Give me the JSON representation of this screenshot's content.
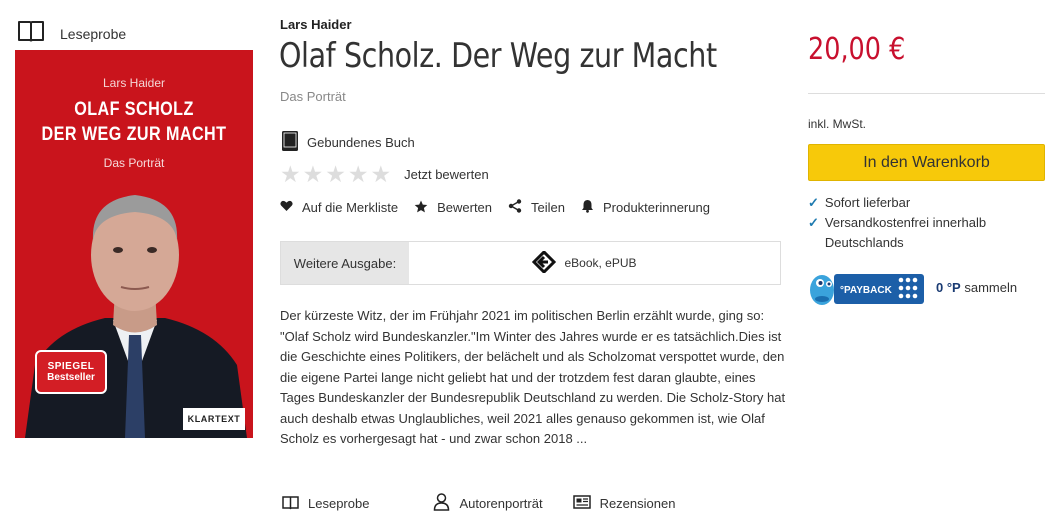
{
  "leseprobe_top": {
    "label": "Leseprobe",
    "icon": "open-book-icon"
  },
  "cover": {
    "author": "Lars Haider",
    "title_line1": "OLAF SCHOLZ",
    "title_line2": "DER WEG ZUR MACHT",
    "subtitle": "Das Porträt",
    "badge_line1": "SPIEGEL",
    "badge_line2": "Bestseller",
    "publisher": "KLARTEXT",
    "background_color": "#c9141c"
  },
  "product": {
    "author": "Lars Haider",
    "title": "Olaf Scholz. Der Weg zur Macht",
    "subtitle": "Das Porträt",
    "format": "Gebundenes Buch",
    "rating_stars": 0,
    "rating_max": 5,
    "rate_label": "Jetzt bewerten"
  },
  "actions": [
    {
      "label": "Auf die Merkliste",
      "icon": "heart-icon"
    },
    {
      "label": "Bewerten",
      "icon": "star-icon"
    },
    {
      "label": "Teilen",
      "icon": "share-icon"
    },
    {
      "label": "Produkterinnerung",
      "icon": "bell-icon"
    }
  ],
  "edition": {
    "label": "Weitere Ausgabe:",
    "option": "eBook, ePUB"
  },
  "description": "Der kürzeste Witz, der im Frühjahr 2021 im politischen Berlin erzählt wurde, ging so: \"Olaf Scholz wird Bundeskanzler.\"Im Winter des Jahres wurde er es tatsächlich.Dies ist die Geschichte eines Politikers, der belächelt und als Scholzomat verspottet wurde, den die eigene Partei lange nicht geliebt hat und der trotzdem fest daran glaubte, eines Tages Bundeskanzler der Bundesrepublik Deutschland zu werden. Die Scholz-Story hat auch deshalb etwas Unglaubliches, weil 2021 alles genauso gekommen ist, wie Olaf Scholz es vorhergesagt hat - und zwar schon 2018 ...",
  "bottom_tabs": [
    {
      "label": "Leseprobe",
      "icon": "open-book-icon"
    },
    {
      "label": "Autorenporträt",
      "icon": "person-icon"
    },
    {
      "label": "Rezensionen",
      "icon": "newspaper-icon"
    }
  ],
  "purchase": {
    "price": "20,00 €",
    "vat_note": "inkl. MwSt.",
    "cart_label": "In den Warenkorb",
    "availability": [
      "Sofort lieferbar",
      "Versandkostenfrei innerhalb Deutschlands"
    ],
    "payback_logo_text": "°PAYBACK",
    "payback_points": "0 °P",
    "payback_suffix": "sammeln",
    "price_color": "#c8102e",
    "cart_color": "#f7c90a"
  }
}
